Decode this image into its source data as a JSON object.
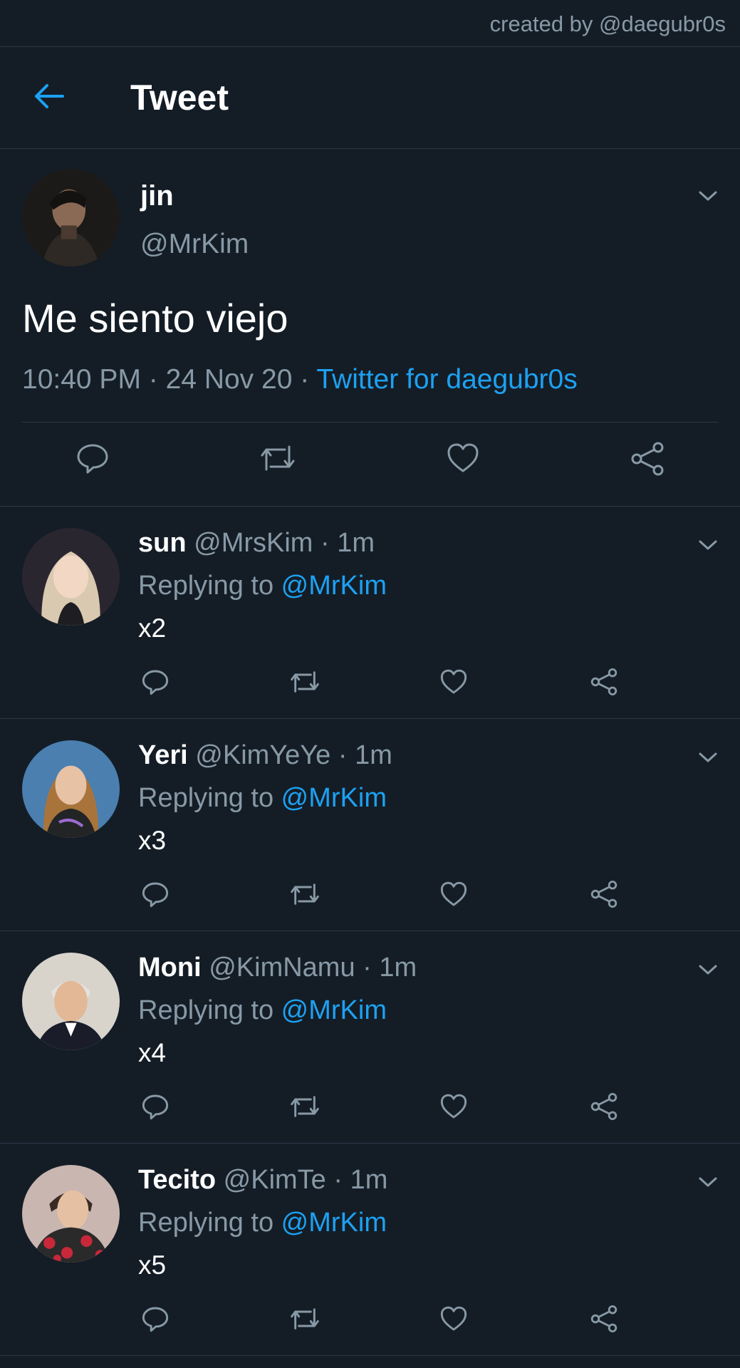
{
  "watermark": "created by @daegubr0s",
  "header": {
    "title": "Tweet"
  },
  "colors": {
    "background": "#141d26",
    "accent": "#1da1f2",
    "muted": "#8899a6",
    "divider": "#2b3845"
  },
  "main_tweet": {
    "name": "jin",
    "handle": "@MrKim",
    "text": "Me siento viejo",
    "time": "10:40 PM",
    "sep1": " · ",
    "date": "24 Nov 20",
    "sep2": " · ",
    "source": "Twitter for daegubr0s",
    "avatar_icon": "avatar-photo",
    "actions": [
      "reply-icon",
      "retweet-icon",
      "like-icon",
      "share-icon"
    ]
  },
  "replies": [
    {
      "name": "sun",
      "handle": "@MrsKim",
      "sep": " · ",
      "time": "1m",
      "replying_prefix": "Replying to ",
      "mention": "@MrKim",
      "text": "x2"
    },
    {
      "name": "Yeri",
      "handle": "@KimYeYe",
      "sep": " · ",
      "time": "1m",
      "replying_prefix": "Replying to ",
      "mention": "@MrKim",
      "text": "x3"
    },
    {
      "name": "Moni",
      "handle": "@KimNamu",
      "sep": " · ",
      "time": "1m",
      "replying_prefix": "Replying to ",
      "mention": "@MrKim",
      "text": "x4"
    },
    {
      "name": "Tecito",
      "handle": "@KimTe",
      "sep": " · ",
      "time": "1m",
      "replying_prefix": "Replying to ",
      "mention": "@MrKim",
      "text": "x5"
    }
  ]
}
